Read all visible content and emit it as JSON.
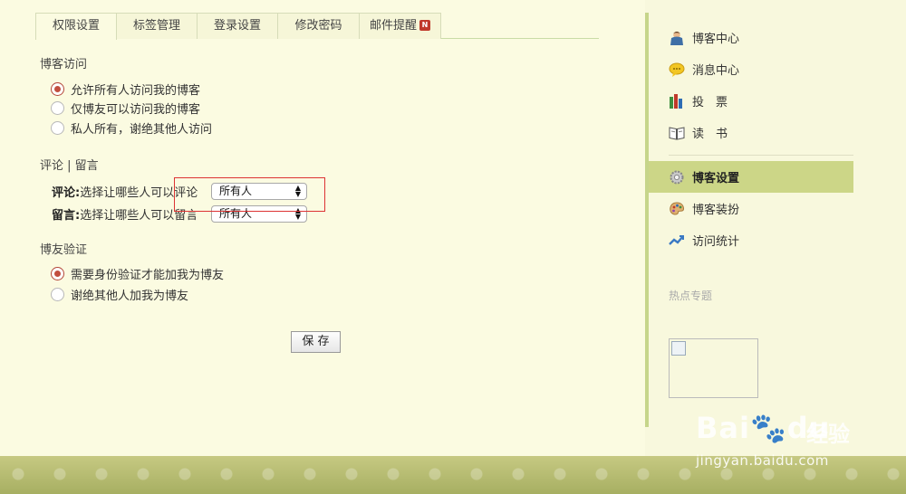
{
  "tabs": [
    {
      "label": "权限设置",
      "active": true
    },
    {
      "label": "标签管理",
      "active": false
    },
    {
      "label": "登录设置",
      "active": false
    },
    {
      "label": "修改密码",
      "active": false
    },
    {
      "label": "邮件提醒",
      "active": false,
      "badge": "N"
    }
  ],
  "blog_access": {
    "title": "博客访问",
    "options": [
      {
        "label": "允许所有人访问我的博客",
        "checked": true
      },
      {
        "label": "仅博友可以访问我的博客",
        "checked": false
      },
      {
        "label": "私人所有，谢绝其他人访问",
        "checked": false
      }
    ]
  },
  "comments": {
    "title": "评论 | 留言",
    "comment_label": "评论:",
    "comment_desc": "选择让哪些人可以评论",
    "comment_value": "所有人",
    "message_label": "留言:",
    "message_desc": "选择让哪些人可以留言",
    "message_value": "所有人"
  },
  "friend_verify": {
    "title": "博友验证",
    "options": [
      {
        "label": "需要身份验证才能加我为博友",
        "checked": true
      },
      {
        "label": "谢绝其他人加我为博友",
        "checked": false
      }
    ]
  },
  "save_label": "保 存",
  "sidebar": {
    "items": [
      {
        "label": "博客中心",
        "icon": "person-icon"
      },
      {
        "label": "消息中心",
        "icon": "chat-bubble-icon"
      },
      {
        "label": "投　票",
        "icon": "bar-chart-icon"
      },
      {
        "label": "读　书",
        "icon": "book-icon"
      },
      {
        "label": "博客设置",
        "icon": "gear-icon",
        "active": true
      },
      {
        "label": "博客装扮",
        "icon": "palette-icon"
      },
      {
        "label": "访问统计",
        "icon": "stats-icon"
      }
    ],
    "hot_topics": "热点专题"
  },
  "watermark": {
    "brand": "Bai",
    "brand2": "du",
    "cn": "经验",
    "url": "jingyan.baidu.com"
  },
  "colors": {
    "accent_green": "#ccd687",
    "radio_red": "#c24e3f",
    "highlight_red": "#dd3333"
  }
}
